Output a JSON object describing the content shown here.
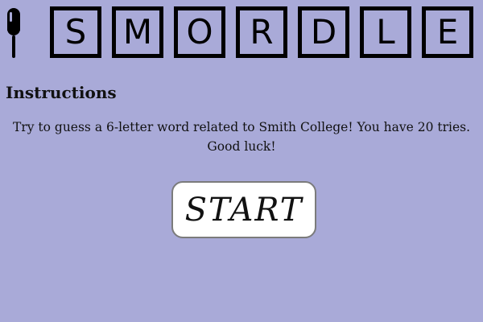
{
  "header": {
    "logo_icon": "popsicle-icon",
    "title_letters": [
      "S",
      "M",
      "O",
      "R",
      "D",
      "L",
      "E"
    ]
  },
  "instructions": {
    "heading": "Instructions",
    "text": "Try to guess a 6-letter word related to Smith College! You have 20 tries. Good luck!"
  },
  "start_button": {
    "label": "START"
  },
  "colors": {
    "background": "#a9aad8",
    "tile_border": "#000000",
    "button_bg": "#ffffff"
  }
}
